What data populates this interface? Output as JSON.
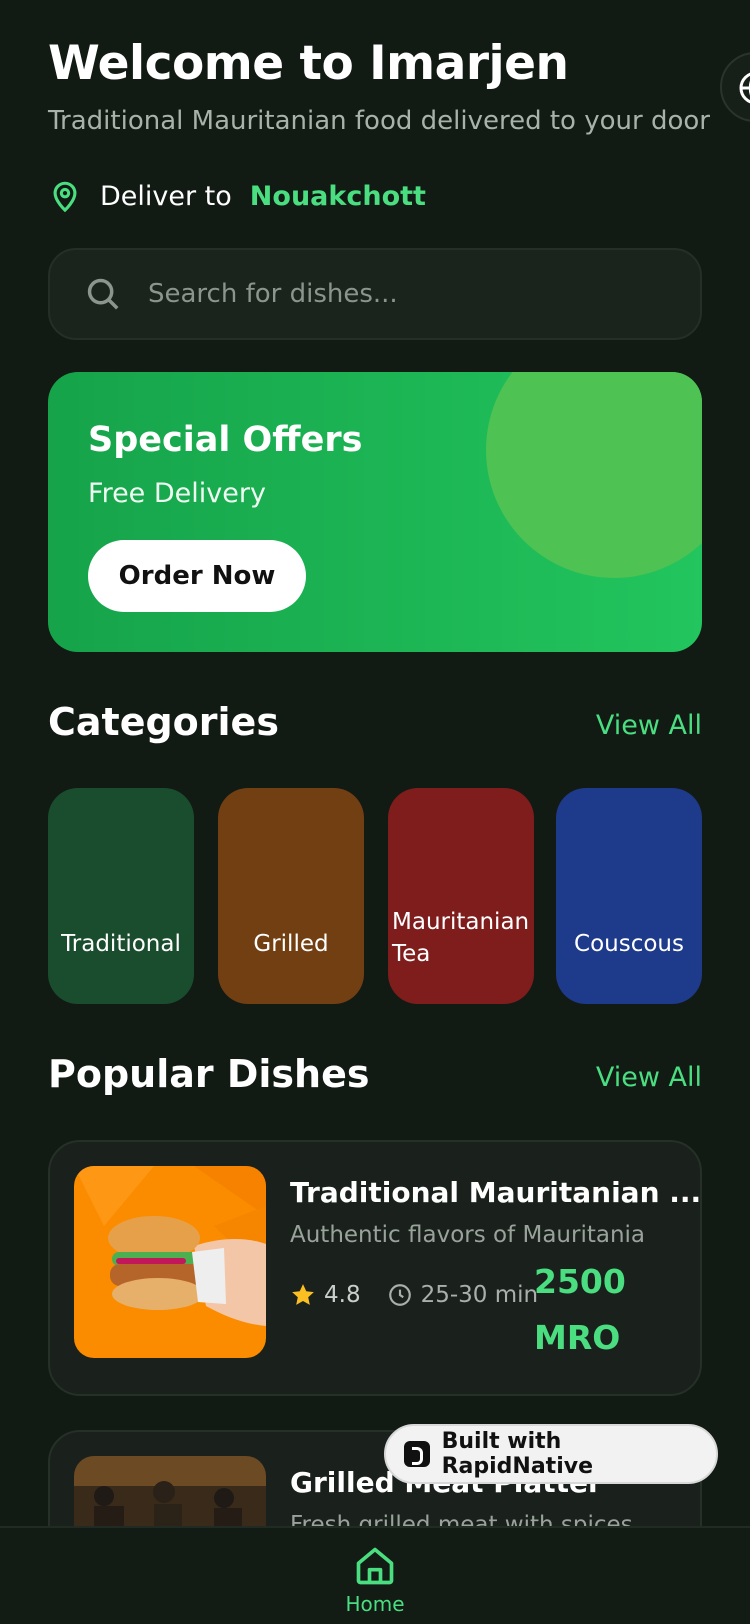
{
  "header": {
    "title": "Welcome to Imarjen",
    "subtitle": "Traditional Mauritanian food delivered to your door"
  },
  "location": {
    "label": "Deliver to",
    "city": "Nouakchott"
  },
  "search": {
    "placeholder": "Search for dishes..."
  },
  "banner": {
    "title": "Special Offers",
    "subtitle": "Free Delivery",
    "button": "Order Now"
  },
  "categories": {
    "title": "Categories",
    "view_all": "View All",
    "items": [
      {
        "label": "Traditional",
        "color": "#1a4d2e"
      },
      {
        "label": "Grilled",
        "color": "#713f12"
      },
      {
        "label": "Mauritanian Tea",
        "color": "#7f1d1d"
      },
      {
        "label": "Couscous",
        "color": "#1e3a8a"
      }
    ]
  },
  "popular": {
    "title": "Popular Dishes",
    "view_all": "View All",
    "dishes": [
      {
        "name": "Traditional Mauritanian ...",
        "description": "Authentic flavors of Mauritania",
        "rating": "4.8",
        "time": "25-30 min",
        "price_value": "2500",
        "price_currency": "MRO"
      },
      {
        "name": "Grilled Meat Platter",
        "description": "Fresh grilled meat with spices"
      }
    ]
  },
  "badge": {
    "text": "Built with RapidNative"
  },
  "tabbar": {
    "home": "Home"
  },
  "colors": {
    "accent": "#4ade80",
    "background": "#121a14",
    "banner": "#22c55e"
  }
}
